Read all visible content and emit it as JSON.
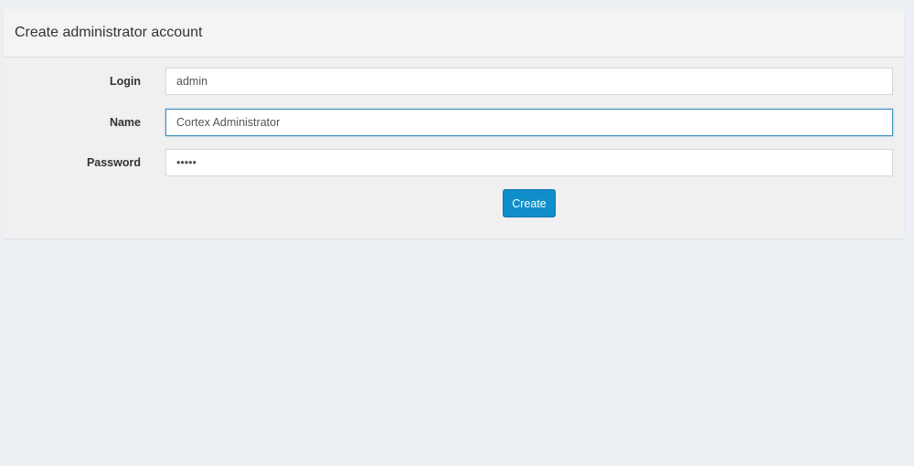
{
  "panel": {
    "title": "Create administrator account"
  },
  "form": {
    "login": {
      "label": "Login",
      "value": "admin"
    },
    "name": {
      "label": "Name",
      "value": "Cortex Administrator"
    },
    "password": {
      "label": "Password",
      "value": "admin"
    },
    "submit_label": "Create"
  },
  "colors": {
    "page_background": "#ecf0f5",
    "panel_background": "#f0f0f0",
    "focus_border": "#3c8dbc",
    "button_background": "#0f8ec9"
  }
}
